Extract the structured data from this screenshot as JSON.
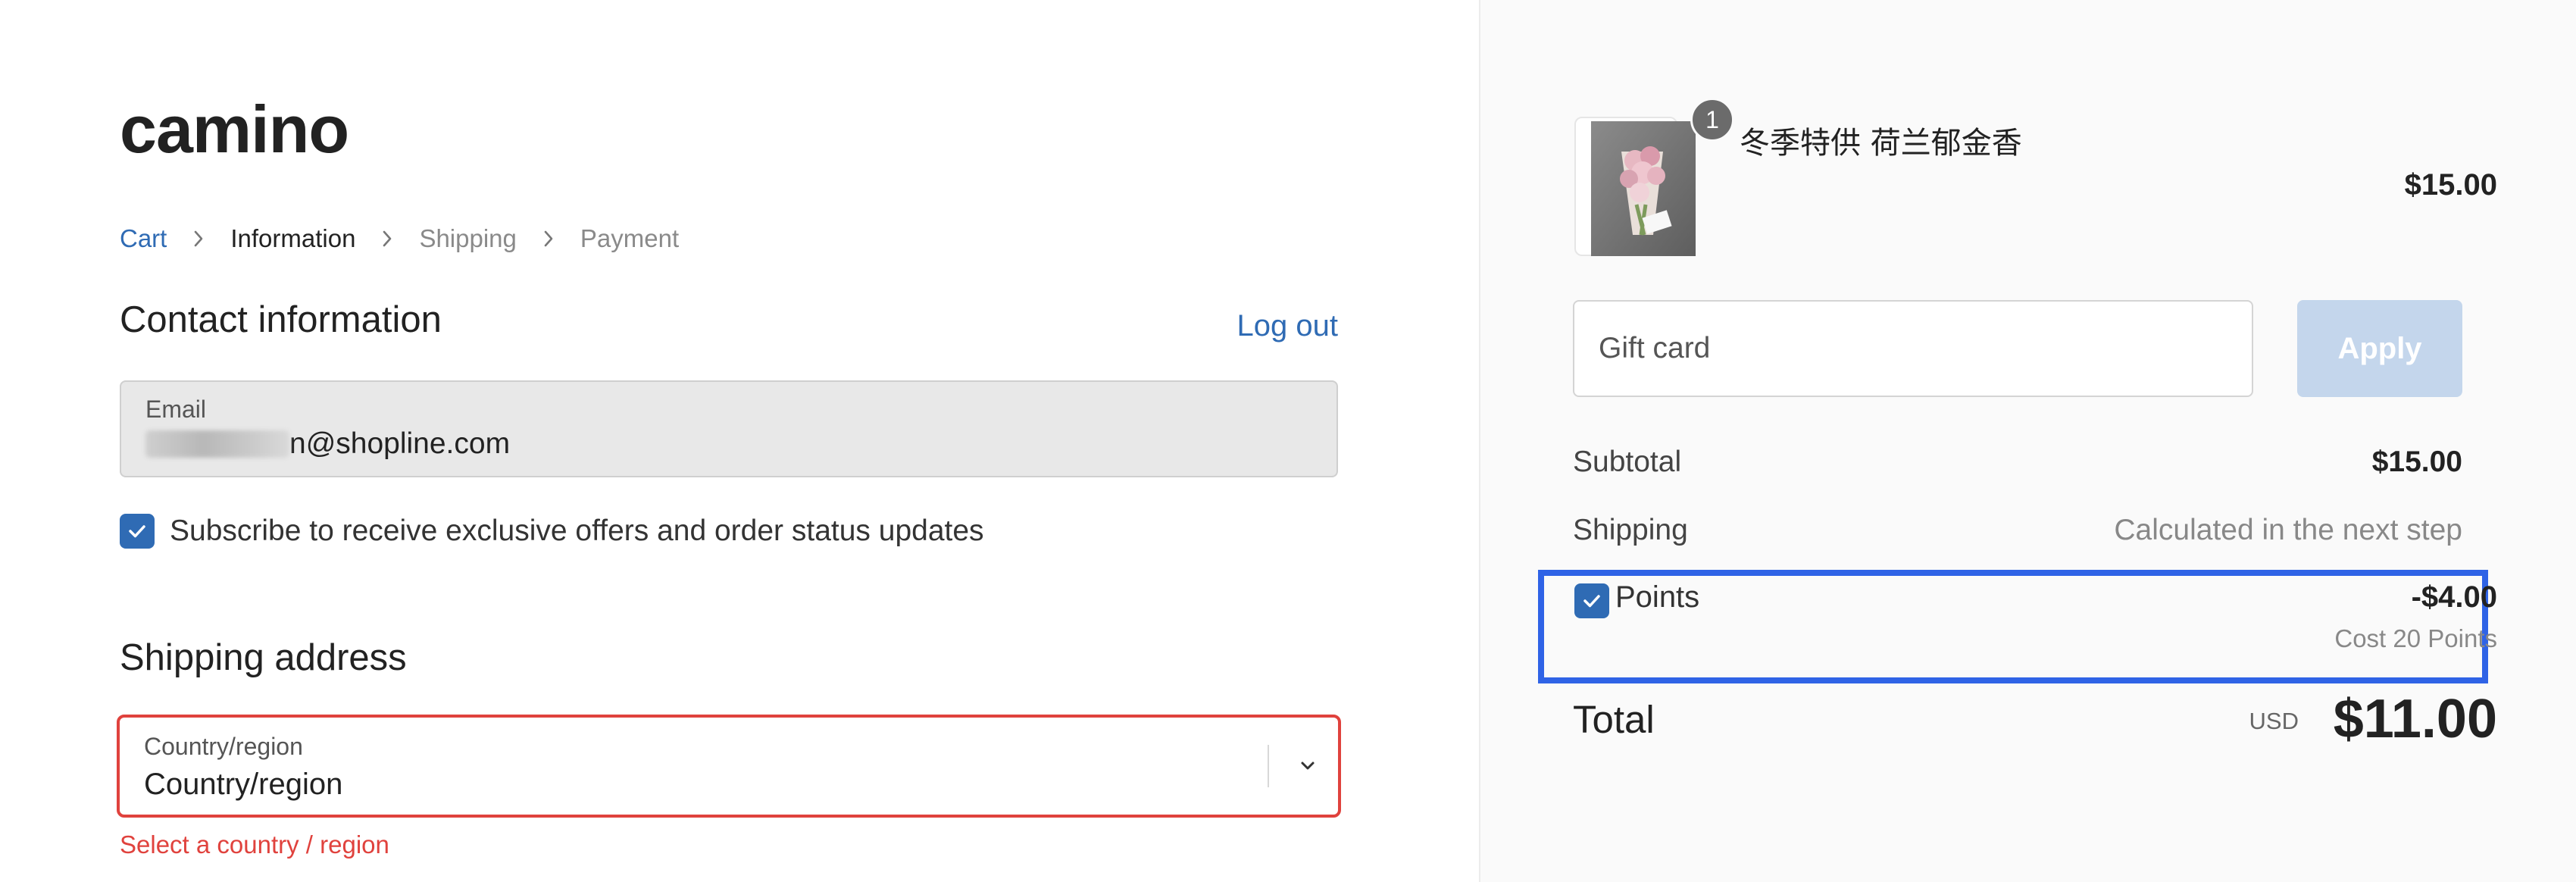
{
  "shop": {
    "name": "camino"
  },
  "breadcrumb": {
    "items": [
      {
        "label": "Cart",
        "state": "link"
      },
      {
        "label": "Information",
        "state": "current"
      },
      {
        "label": "Shipping",
        "state": "future"
      },
      {
        "label": "Payment",
        "state": "future"
      }
    ]
  },
  "contact": {
    "title": "Contact information",
    "logout_label": "Log out",
    "email": {
      "label": "Email",
      "value_visible": "n@shopline.com"
    },
    "subscribe": {
      "checked": true,
      "label": "Subscribe to receive exclusive offers and order status updates"
    }
  },
  "shipping_address": {
    "title": "Shipping address",
    "country": {
      "label": "Country/region",
      "value": "Country/region",
      "error": "Select a country / region"
    }
  },
  "order": {
    "item": {
      "quantity": "1",
      "name": "冬季特供 荷兰郁金香",
      "price": "$15.00"
    },
    "gift_card": {
      "placeholder": "Gift card",
      "apply_label": "Apply"
    },
    "subtotal": {
      "label": "Subtotal",
      "value": "$15.00"
    },
    "shipping": {
      "label": "Shipping",
      "value": "Calculated in the next step"
    },
    "points": {
      "checked": true,
      "label": "Points",
      "amount": "-$4.00",
      "cost": "Cost 20 Points"
    },
    "total": {
      "label": "Total",
      "currency": "USD",
      "amount": "$11.00"
    }
  },
  "colors": {
    "accent": "#2f6bb4",
    "error": "#e0423d",
    "highlight_border": "#2f63e6",
    "apply_disabled": "#c4d6ec"
  }
}
